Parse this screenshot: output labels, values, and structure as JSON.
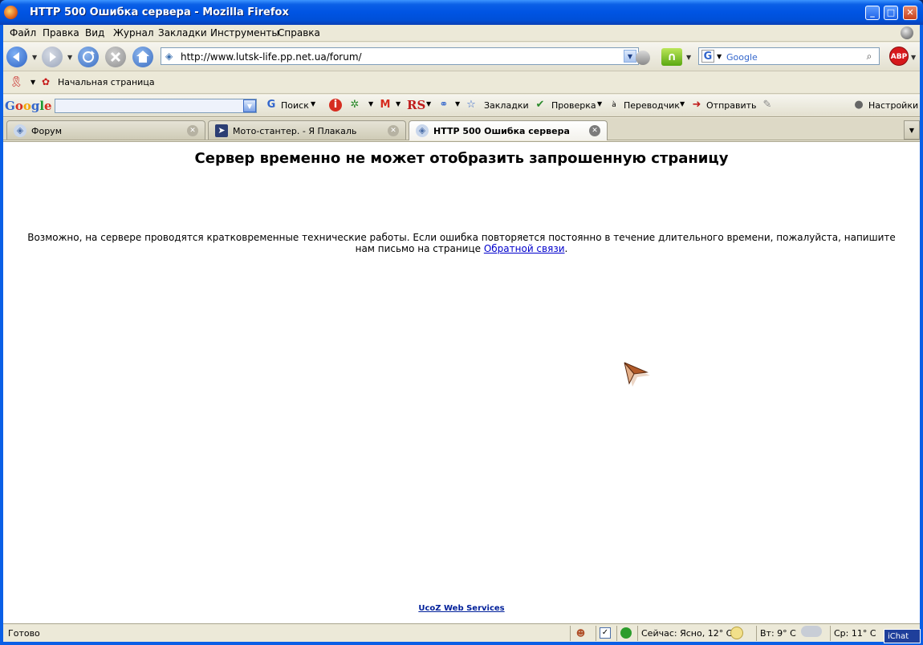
{
  "window": {
    "title": "HTTP 500 Ошибка сервера - Mozilla Firefox"
  },
  "menu": [
    "Файл",
    "Правка",
    "Вид",
    "Журнал",
    "Закладки",
    "Инструменты",
    "Справка"
  ],
  "nav": {
    "url": "http://www.lutsk-life.pp.net.ua/forum/",
    "search_placeholder": "Google"
  },
  "bookmarks": {
    "home": "Начальная страница"
  },
  "google_toolbar": {
    "search": "Поиск",
    "bookmarks": "Закладки",
    "check": "Проверка",
    "translate": "Переводчик",
    "send": "Отправить",
    "settings": "Настройки",
    "rs": "RS"
  },
  "tabs": [
    {
      "label": "Форум",
      "active": false
    },
    {
      "label": "Мото-стантер. - Я Плакаль",
      "active": false
    },
    {
      "label": "HTTP 500 Ошибка сервера",
      "active": true
    }
  ],
  "content": {
    "heading": "Сервер временно не может отобразить запрошенную страницу",
    "message": "Возможно, на сервере проводятся кратковременные технические работы. Если ошибка повторяется постоянно в течение длительного времени, пожалуйста, напишите нам письмо на странице ",
    "link": "Обратной связи",
    "message_end": ".",
    "footer": "UcoZ Web Services"
  },
  "status": {
    "text": "Готово",
    "weather_now": "Сейчас: Ясно, 12° C",
    "tue": "Вт: 9° C",
    "wed": "Ср: 11° C",
    "ichat": "iChat"
  },
  "colors": {
    "titlebar": "#0054e3",
    "frame": "#ece9d8",
    "link": "#0000cc"
  }
}
